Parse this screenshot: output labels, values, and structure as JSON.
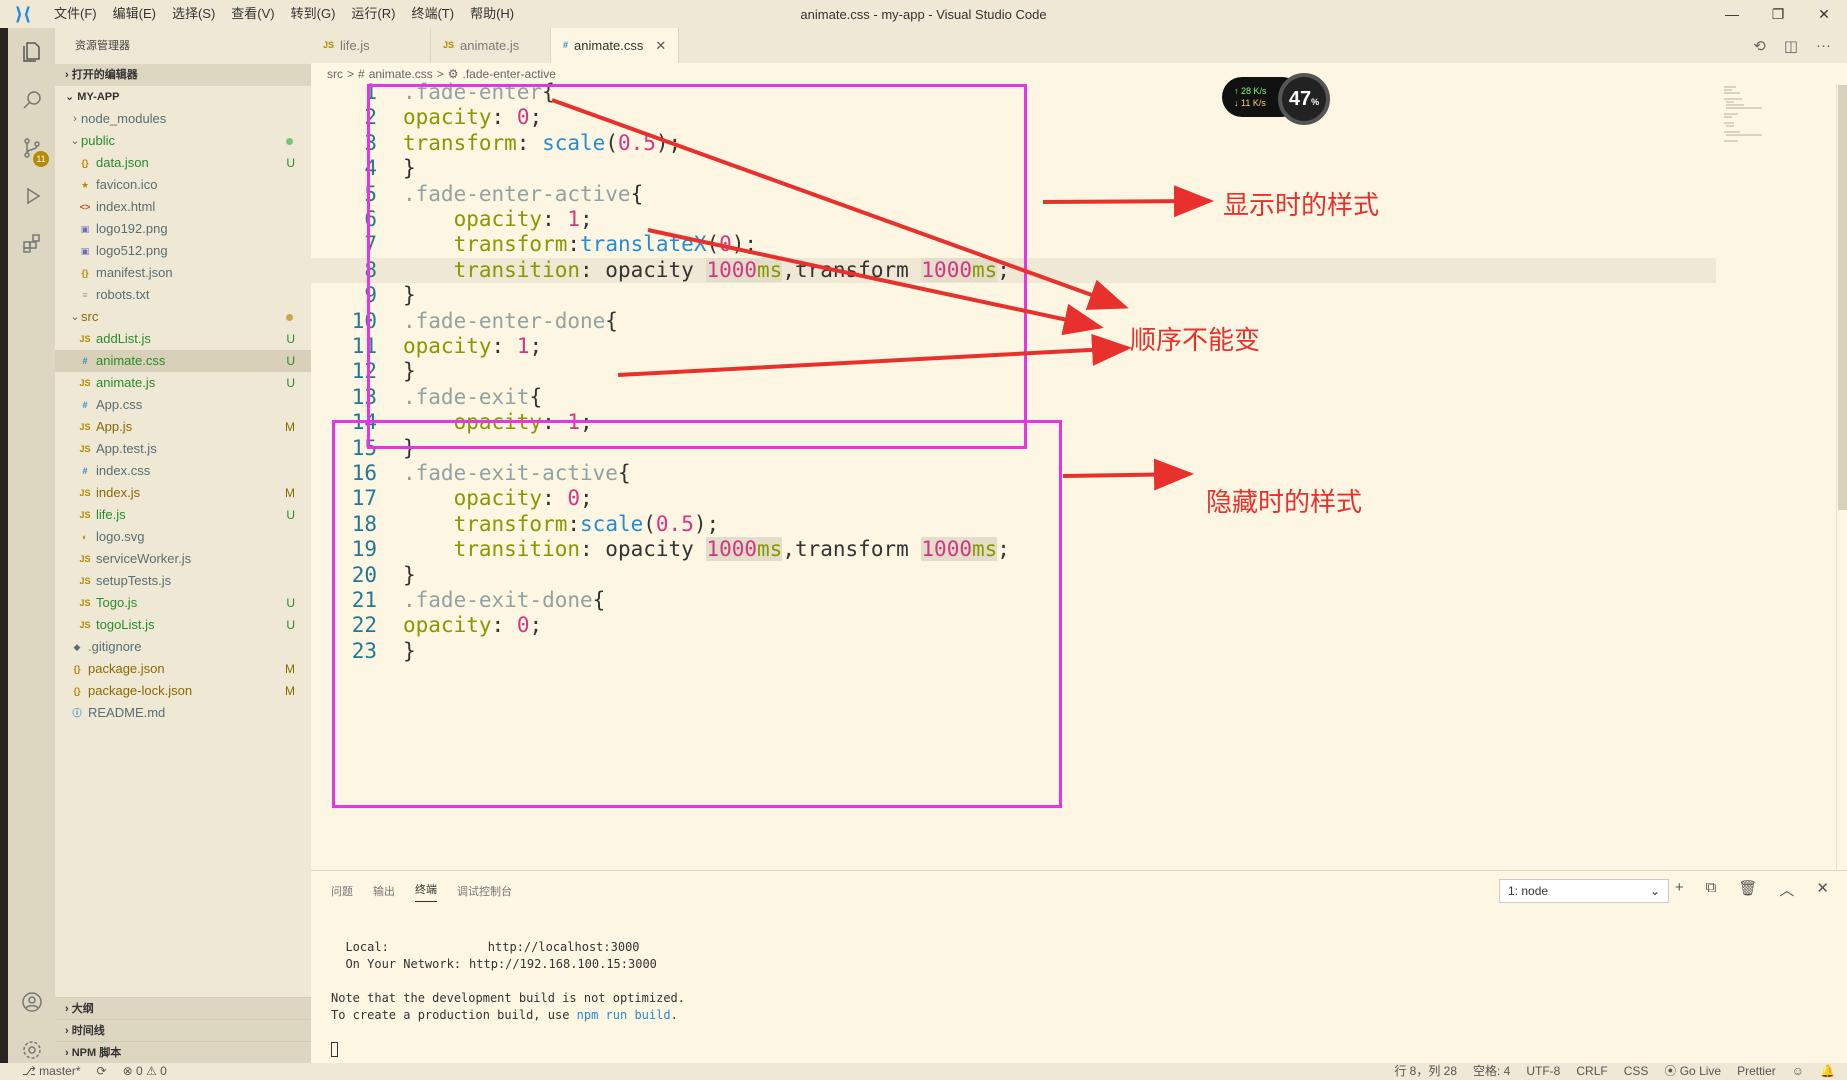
{
  "window": {
    "title": "animate.css - my-app - Visual Studio Code",
    "menu": [
      "文件(F)",
      "编辑(E)",
      "选择(S)",
      "查看(V)",
      "转到(G)",
      "运行(R)",
      "终端(T)",
      "帮助(H)"
    ],
    "controls": {
      "minimize": "—",
      "restore": "❐",
      "close": "✕"
    }
  },
  "activity_bar": {
    "scm_badge": "11",
    "icons": [
      "files-icon",
      "search-icon",
      "source-control-icon",
      "run-debug-icon",
      "extensions-icon",
      "account-icon",
      "settings-gear-icon"
    ]
  },
  "sidebar": {
    "title": "资源管理器",
    "open_editors": "打开的编辑器",
    "project": "MY-APP",
    "tree": [
      {
        "name": "node_modules",
        "type": "folder",
        "indent": 0,
        "expanded": false,
        "status": "",
        "color": "#586e75",
        "icon": ""
      },
      {
        "name": "public",
        "type": "folder",
        "indent": 0,
        "expanded": true,
        "status": "dot-green",
        "color": "#2a8c2a",
        "icon": ""
      },
      {
        "name": "data.json",
        "type": "file",
        "indent": 1,
        "status": "U",
        "color": "#2a8c2a",
        "icon": "{}",
        "icon_color": "#b58900"
      },
      {
        "name": "favicon.ico",
        "type": "file",
        "indent": 1,
        "status": "",
        "color": "#586e75",
        "icon": "★",
        "icon_color": "#b58900"
      },
      {
        "name": "index.html",
        "type": "file",
        "indent": 1,
        "status": "",
        "color": "#586e75",
        "icon": "<>",
        "icon_color": "#cb4b16"
      },
      {
        "name": "logo192.png",
        "type": "file",
        "indent": 1,
        "status": "",
        "color": "#586e75",
        "icon": "▣",
        "icon_color": "#6c71c4"
      },
      {
        "name": "logo512.png",
        "type": "file",
        "indent": 1,
        "status": "",
        "color": "#586e75",
        "icon": "▣",
        "icon_color": "#6c71c4"
      },
      {
        "name": "manifest.json",
        "type": "file",
        "indent": 1,
        "status": "",
        "color": "#586e75",
        "icon": "{}",
        "icon_color": "#b58900"
      },
      {
        "name": "robots.txt",
        "type": "file",
        "indent": 1,
        "status": "",
        "color": "#586e75",
        "icon": "≡",
        "icon_color": "#93a1a1"
      },
      {
        "name": "src",
        "type": "folder",
        "indent": 0,
        "expanded": true,
        "status": "dot-yellow",
        "color": "#8a6a00",
        "icon": ""
      },
      {
        "name": "addList.js",
        "type": "file",
        "indent": 1,
        "status": "U",
        "color": "#2a8c2a",
        "icon": "JS",
        "icon_color": "#b58900"
      },
      {
        "name": "animate.css",
        "type": "file",
        "indent": 1,
        "status": "U",
        "color": "#2a8c2a",
        "icon": "#",
        "icon_color": "#268bd2",
        "selected": true
      },
      {
        "name": "animate.js",
        "type": "file",
        "indent": 1,
        "status": "U",
        "color": "#2a8c2a",
        "icon": "JS",
        "icon_color": "#b58900"
      },
      {
        "name": "App.css",
        "type": "file",
        "indent": 1,
        "status": "",
        "color": "#586e75",
        "icon": "#",
        "icon_color": "#268bd2"
      },
      {
        "name": "App.js",
        "type": "file",
        "indent": 1,
        "status": "M",
        "color": "#8a6a00",
        "icon": "JS",
        "icon_color": "#b58900"
      },
      {
        "name": "App.test.js",
        "type": "file",
        "indent": 1,
        "status": "",
        "color": "#586e75",
        "icon": "JS",
        "icon_color": "#b58900"
      },
      {
        "name": "index.css",
        "type": "file",
        "indent": 1,
        "status": "",
        "color": "#586e75",
        "icon": "#",
        "icon_color": "#268bd2"
      },
      {
        "name": "index.js",
        "type": "file",
        "indent": 1,
        "status": "M",
        "color": "#8a6a00",
        "icon": "JS",
        "icon_color": "#b58900"
      },
      {
        "name": "life.js",
        "type": "file",
        "indent": 1,
        "status": "U",
        "color": "#2a8c2a",
        "icon": "JS",
        "icon_color": "#b58900"
      },
      {
        "name": "logo.svg",
        "type": "file",
        "indent": 1,
        "status": "",
        "color": "#586e75",
        "icon": "◐",
        "icon_color": "#b58900"
      },
      {
        "name": "serviceWorker.js",
        "type": "file",
        "indent": 1,
        "status": "",
        "color": "#586e75",
        "icon": "JS",
        "icon_color": "#b58900"
      },
      {
        "name": "setupTests.js",
        "type": "file",
        "indent": 1,
        "status": "",
        "color": "#586e75",
        "icon": "JS",
        "icon_color": "#b58900"
      },
      {
        "name": "Togo.js",
        "type": "file",
        "indent": 1,
        "status": "U",
        "color": "#2a8c2a",
        "icon": "JS",
        "icon_color": "#b58900"
      },
      {
        "name": "togoList.js",
        "type": "file",
        "indent": 1,
        "status": "U",
        "color": "#2a8c2a",
        "icon": "JS",
        "icon_color": "#b58900"
      },
      {
        "name": ".gitignore",
        "type": "file",
        "indent": 0,
        "status": "",
        "color": "#586e75",
        "icon": "◆",
        "icon_color": "#586e75"
      },
      {
        "name": "package.json",
        "type": "file",
        "indent": 0,
        "status": "M",
        "color": "#8a6a00",
        "icon": "{}",
        "icon_color": "#b58900"
      },
      {
        "name": "package-lock.json",
        "type": "file",
        "indent": 0,
        "status": "M",
        "color": "#8a6a00",
        "icon": "{}",
        "icon_color": "#b58900"
      },
      {
        "name": "README.md",
        "type": "file",
        "indent": 0,
        "status": "",
        "color": "#586e75",
        "icon": "ⓘ",
        "icon_color": "#268bd2"
      }
    ],
    "bottom_sections": [
      "大纲",
      "时间线",
      "NPM 脚本"
    ]
  },
  "tabs": [
    {
      "label": "life.js",
      "icon": "JS",
      "icon_color": "#b58900",
      "active": false
    },
    {
      "label": "animate.js",
      "icon": "JS",
      "icon_color": "#b58900",
      "active": false
    },
    {
      "label": "animate.css",
      "icon": "#",
      "icon_color": "#268bd2",
      "active": true
    }
  ],
  "breadcrumb": [
    "src",
    ">",
    "#",
    "animate.css",
    ">",
    "⚙",
    ".fade-enter-active"
  ],
  "editor": {
    "current_line": 8,
    "lines": [
      [
        [
          "sel",
          ".fade-enter"
        ],
        [
          "punc",
          "{"
        ]
      ],
      [
        [
          "prop",
          "opacity"
        ],
        [
          "punc",
          ": "
        ],
        [
          "num",
          "0"
        ],
        [
          "punc",
          ";"
        ]
      ],
      [
        [
          "prop",
          "transform"
        ],
        [
          "punc",
          ": "
        ],
        [
          "fn",
          "scale"
        ],
        [
          "punc",
          "("
        ],
        [
          "num",
          "0.5"
        ],
        [
          "punc",
          ");"
        ]
      ],
      [
        [
          "punc",
          "}"
        ]
      ],
      [
        [
          "sel",
          ".fade-enter-active"
        ],
        [
          "punc",
          "{"
        ]
      ],
      [
        [
          "punc",
          "    "
        ],
        [
          "prop",
          "opacity"
        ],
        [
          "punc",
          ": "
        ],
        [
          "num",
          "1"
        ],
        [
          "punc",
          ";"
        ]
      ],
      [
        [
          "punc",
          "    "
        ],
        [
          "prop",
          "transform"
        ],
        [
          "punc",
          ":"
        ],
        [
          "fn",
          "translateX"
        ],
        [
          "punc",
          "("
        ],
        [
          "num",
          "0"
        ],
        [
          "punc",
          ");"
        ]
      ],
      [
        [
          "punc",
          "    "
        ],
        [
          "prop",
          "transition"
        ],
        [
          "punc",
          ": opacity "
        ],
        [
          "numhl",
          "1000"
        ],
        [
          "prophl",
          "ms"
        ],
        [
          "punc",
          ",transform "
        ],
        [
          "numhl",
          "1000"
        ],
        [
          "prophl",
          "ms"
        ],
        [
          "punc",
          ";"
        ]
      ],
      [
        [
          "punc",
          "}"
        ]
      ],
      [
        [
          "sel",
          ".fade-enter-done"
        ],
        [
          "punc",
          "{"
        ]
      ],
      [
        [
          "prop",
          "opacity"
        ],
        [
          "punc",
          ": "
        ],
        [
          "num",
          "1"
        ],
        [
          "punc",
          ";"
        ]
      ],
      [
        [
          "punc",
          "}"
        ]
      ],
      [
        [
          "sel",
          ".fade-exit"
        ],
        [
          "punc",
          "{"
        ]
      ],
      [
        [
          "punc",
          "    "
        ],
        [
          "prop",
          "opacity"
        ],
        [
          "punc",
          ": "
        ],
        [
          "num",
          "1"
        ],
        [
          "punc",
          ";"
        ]
      ],
      [
        [
          "punc",
          "}"
        ]
      ],
      [
        [
          "sel",
          ".fade-exit-active"
        ],
        [
          "punc",
          "{"
        ]
      ],
      [
        [
          "punc",
          "    "
        ],
        [
          "prop",
          "opacity"
        ],
        [
          "punc",
          ": "
        ],
        [
          "num",
          "0"
        ],
        [
          "punc",
          ";"
        ]
      ],
      [
        [
          "punc",
          "    "
        ],
        [
          "prop",
          "transform"
        ],
        [
          "punc",
          ":"
        ],
        [
          "fn",
          "scale"
        ],
        [
          "punc",
          "("
        ],
        [
          "num",
          "0.5"
        ],
        [
          "punc",
          ");"
        ]
      ],
      [
        [
          "punc",
          "    "
        ],
        [
          "prop",
          "transition"
        ],
        [
          "punc",
          ": opacity "
        ],
        [
          "numhl",
          "1000"
        ],
        [
          "prophl",
          "ms"
        ],
        [
          "punc",
          ",transform "
        ],
        [
          "numhl",
          "1000"
        ],
        [
          "prophl",
          "ms"
        ],
        [
          "punc",
          ";"
        ]
      ],
      [
        [
          "punc",
          "}"
        ]
      ],
      [
        [
          "sel",
          ".fade-exit-done"
        ],
        [
          "punc",
          "{"
        ]
      ],
      [
        [
          "prop",
          "opacity"
        ],
        [
          "punc",
          ": "
        ],
        [
          "num",
          "0"
        ],
        [
          "punc",
          ";"
        ]
      ],
      [
        [
          "punc",
          "}"
        ]
      ]
    ]
  },
  "net_widget": {
    "up": "↑ 28 K/s",
    "down": "↓ 11 K/s",
    "percent": "47",
    "percent_unit": "%"
  },
  "annotations": {
    "show_style": "显示时的样式",
    "order_fixed": "顺序不能变",
    "hide_style": "隐藏时的样式",
    "box_color": "#e535e5",
    "arrow_color": "#e8312c"
  },
  "panel": {
    "tabs": [
      "问题",
      "输出",
      "终端",
      "调试控制台"
    ],
    "active_tab": "终端",
    "terminal_select": "1: node",
    "actions": [
      "+",
      "⧉",
      "🗑",
      "︿",
      "✕"
    ],
    "terminal": {
      "local_label": "  Local:",
      "local_url": "http://localhost:3000",
      "network_label": "  On Your Network:",
      "network_url": "http://192.168.100.15:3000",
      "note1": "Note that the development build is not optimized.",
      "note2_prefix": "To create a production build, use ",
      "note2_cmd": "npm run build",
      "note2_suffix": "."
    }
  },
  "statusbar": {
    "branch": "master*",
    "sync": "⟳",
    "problems": "⊗ 0 ⚠ 0",
    "position": "行 8，列 28",
    "spaces": "空格: 4",
    "encoding": "UTF-8",
    "eol": "CRLF",
    "language": "CSS",
    "golive": "⦿ Go Live",
    "prettier": "Prettier",
    "feedback": "☺",
    "bell": "🔔"
  }
}
